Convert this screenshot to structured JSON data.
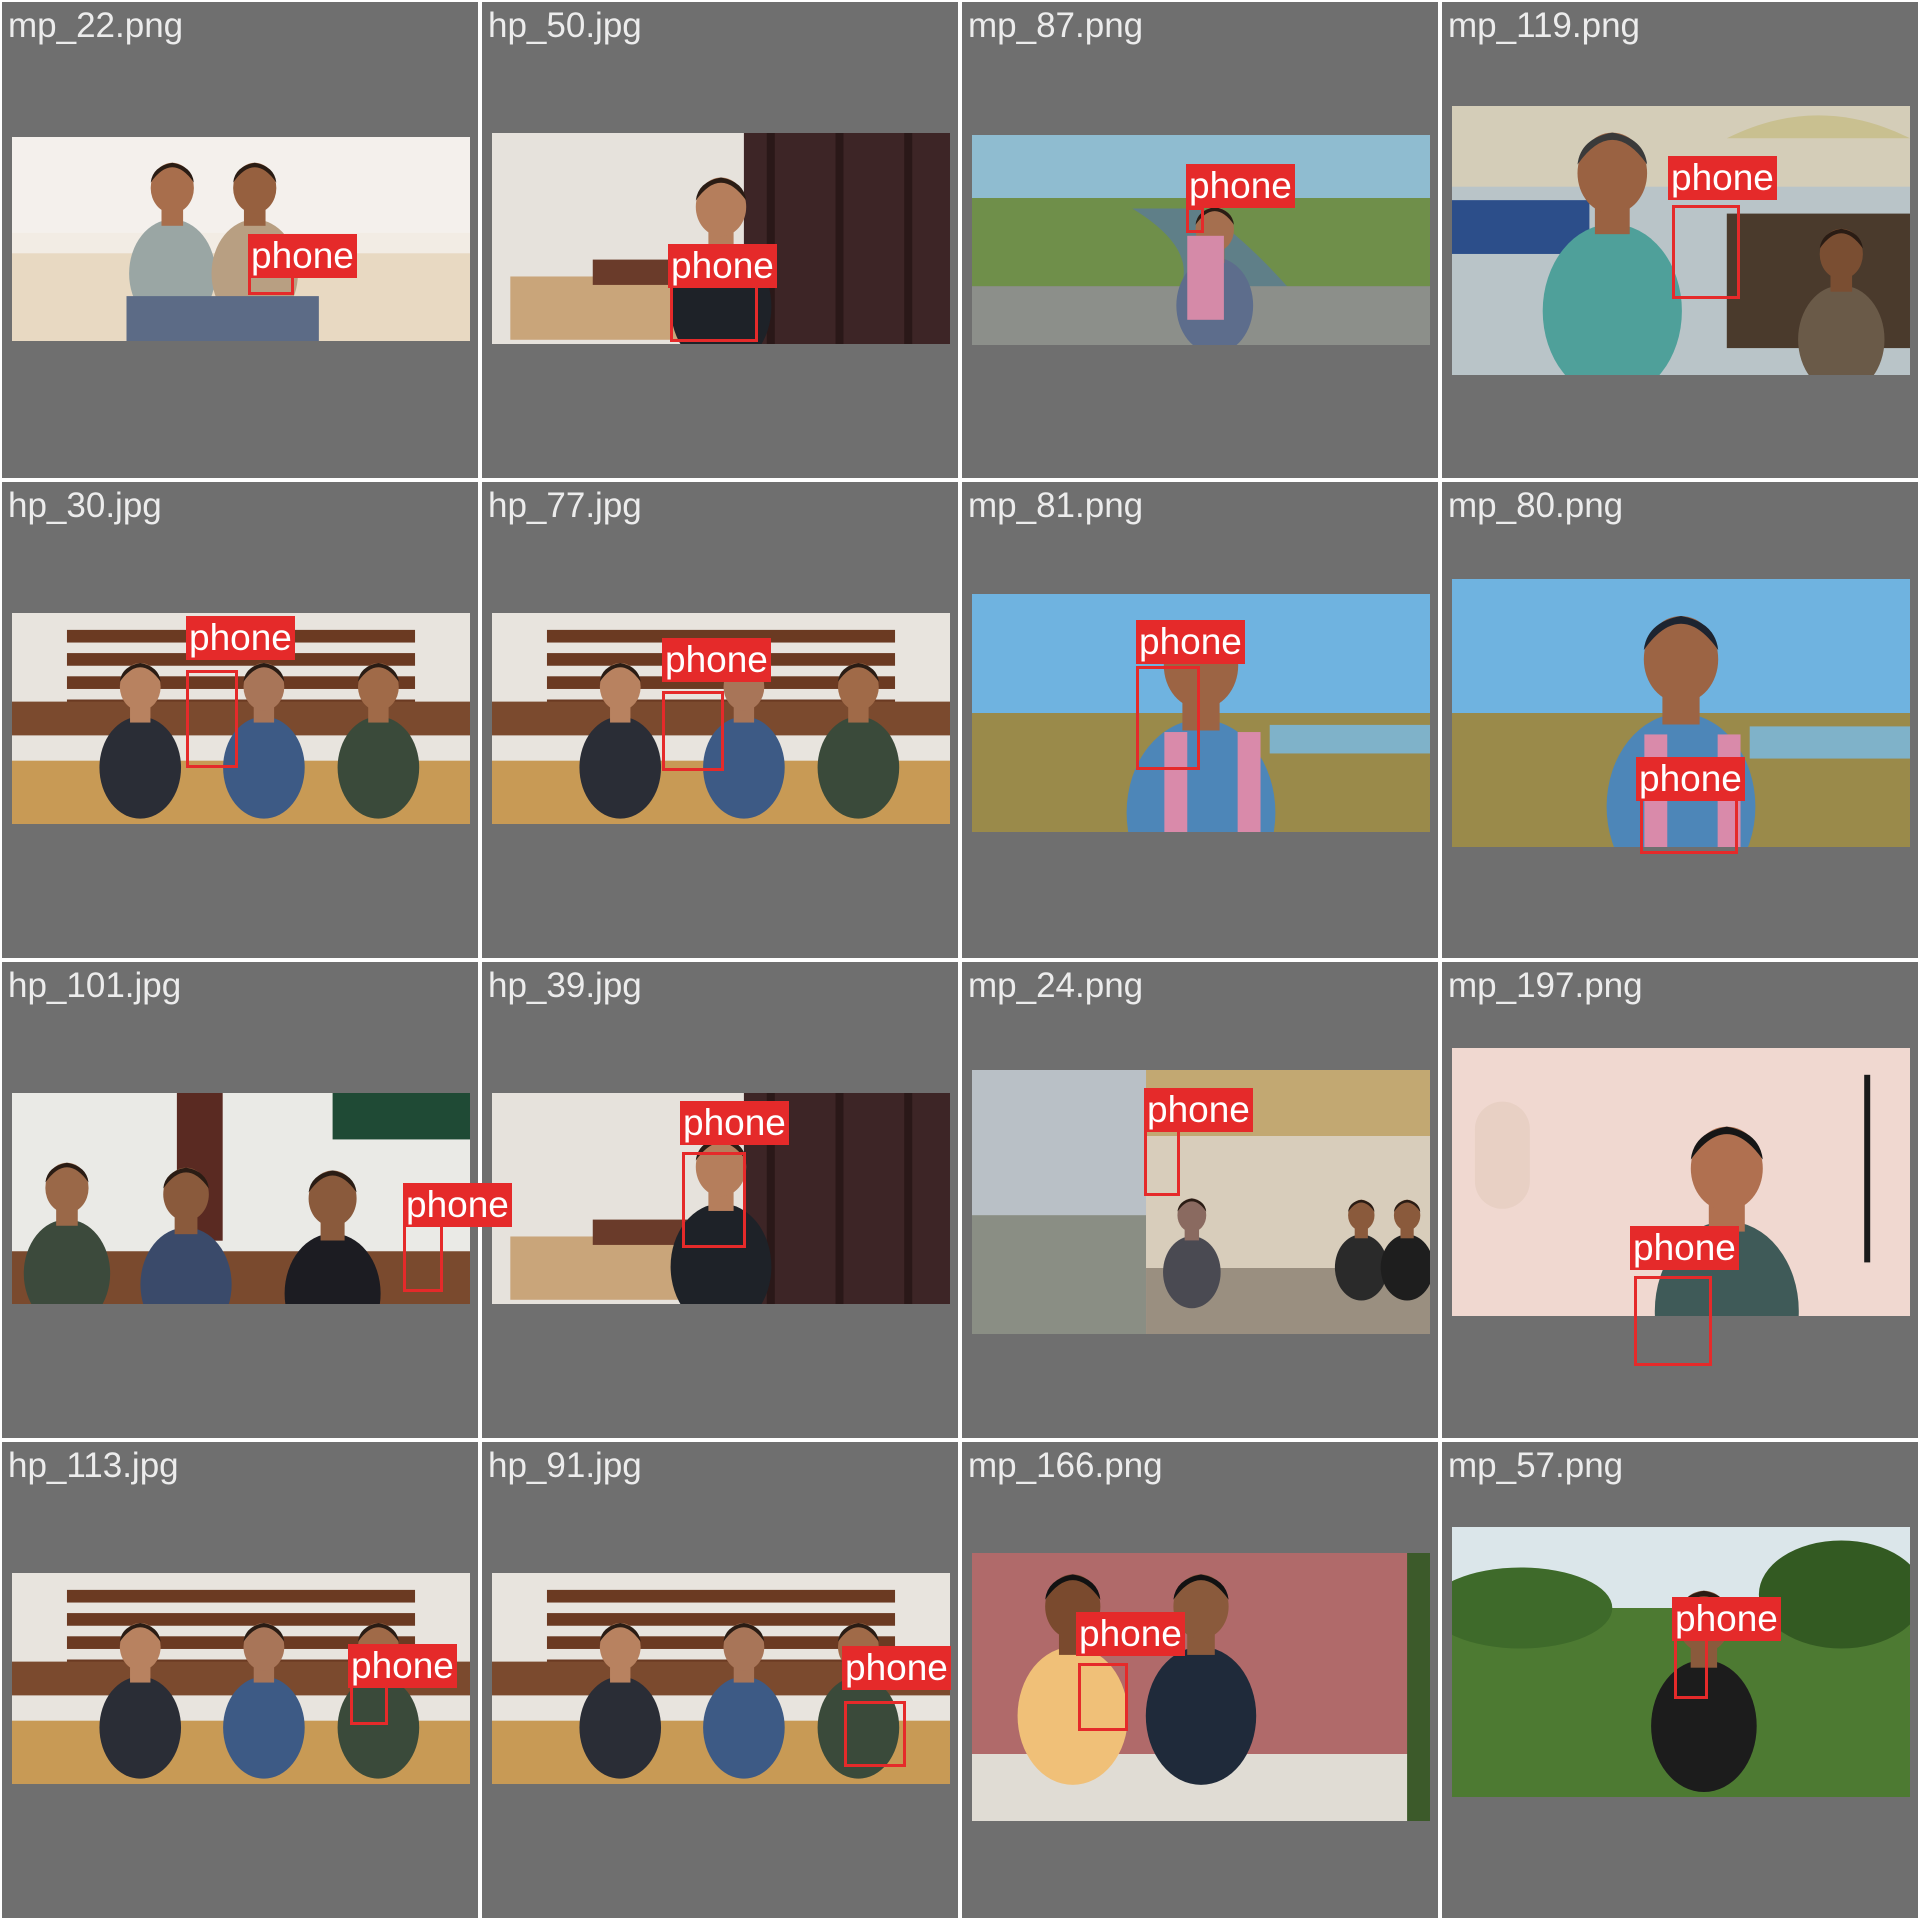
{
  "grid": {
    "cells": [
      {
        "file": "mp_22.png",
        "scene": "outdoor-ledge",
        "detections": [
          {
            "label": "phone"
          }
        ]
      },
      {
        "file": "hp_50.jpg",
        "scene": "classroom-curtain",
        "detections": [
          {
            "label": "phone"
          }
        ]
      },
      {
        "file": "mp_87.png",
        "scene": "riverbank",
        "detections": [
          {
            "label": "phone"
          }
        ]
      },
      {
        "file": "mp_119.png",
        "scene": "street-market",
        "detections": [
          {
            "label": "phone"
          }
        ]
      },
      {
        "file": "hp_30.jpg",
        "scene": "lecture-hall",
        "detections": [
          {
            "label": "phone"
          }
        ]
      },
      {
        "file": "hp_77.jpg",
        "scene": "lecture-hall",
        "detections": [
          {
            "label": "phone"
          }
        ]
      },
      {
        "file": "mp_81.png",
        "scene": "sky-closeup",
        "detections": [
          {
            "label": "phone"
          }
        ]
      },
      {
        "file": "mp_80.png",
        "scene": "sky-closeup",
        "detections": [
          {
            "label": "phone"
          }
        ]
      },
      {
        "file": "hp_101.jpg",
        "scene": "classroom-board",
        "detections": [
          {
            "label": "phone"
          }
        ]
      },
      {
        "file": "hp_39.jpg",
        "scene": "classroom-curtain",
        "detections": [
          {
            "label": "phone"
          }
        ]
      },
      {
        "file": "mp_24.png",
        "scene": "metro-train",
        "detections": [
          {
            "label": "phone"
          }
        ]
      },
      {
        "file": "mp_197.png",
        "scene": "pink-room",
        "detections": [
          {
            "label": "phone"
          }
        ]
      },
      {
        "file": "hp_113.jpg",
        "scene": "lecture-hall",
        "detections": [
          {
            "label": "phone"
          }
        ]
      },
      {
        "file": "hp_91.jpg",
        "scene": "lecture-hall",
        "detections": [
          {
            "label": "phone"
          }
        ]
      },
      {
        "file": "mp_166.png",
        "scene": "red-wall",
        "detections": [
          {
            "label": "phone"
          }
        ]
      },
      {
        "file": "mp_57.png",
        "scene": "green-field",
        "detections": [
          {
            "label": "phone"
          }
        ]
      }
    ]
  },
  "colors": {
    "cell_background": "#6f6f6f",
    "label_text": "#ececec",
    "detection_box": "#e52a2a",
    "detection_text": "#ffffff"
  }
}
